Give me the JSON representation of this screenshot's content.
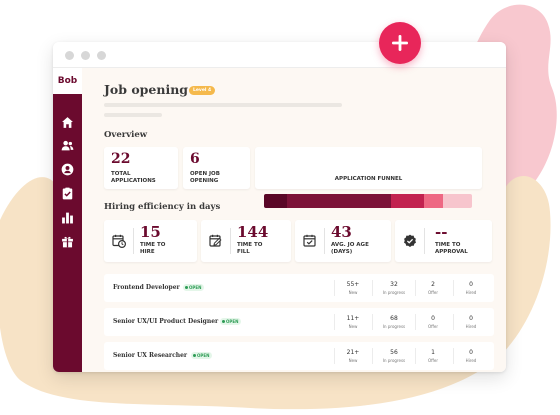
{
  "app": {
    "logo": "Bob"
  },
  "page": {
    "title": "Job opening",
    "badge": "Level 4"
  },
  "overview": {
    "heading": "Overview",
    "total_applications": {
      "value": "22",
      "label": "TOTAL APPLICATIONS"
    },
    "open_job_opening": {
      "value": "6",
      "label": "OPEN JOB OPENING"
    },
    "funnel": {
      "label": "APPLICATION FUNNEL",
      "segments": [
        {
          "fraction": 0.11,
          "color": "#5a0727"
        },
        {
          "fraction": 0.5,
          "color": "#7c1238"
        },
        {
          "fraction": 0.16,
          "color": "#c2224f"
        },
        {
          "fraction": 0.09,
          "color": "#ee6883"
        },
        {
          "fraction": 0.14,
          "color": "#f7c5cd"
        }
      ]
    }
  },
  "efficiency": {
    "heading": "Hiring efficiency in days",
    "time_to_hire": {
      "value": "15",
      "label": "TIME TO HIRE",
      "icon": "clock-calendar-icon"
    },
    "time_to_fill": {
      "value": "144",
      "label": "TIME TO FILL",
      "icon": "calendar-edit-icon"
    },
    "avg_job_age": {
      "value": "43",
      "label": "AVG. JO AGE (DAYS)",
      "icon": "calendar-check-icon"
    },
    "time_to_approval": {
      "value": "--",
      "label": "TIME TO APPROVAL",
      "icon": "check-circle-icon"
    }
  },
  "jobs": {
    "column_labels": {
      "new": "New",
      "in_progress": "In progress",
      "offer": "Offer",
      "hired": "Hired"
    },
    "status_label": "OPEN",
    "rows": [
      {
        "title": "Frontend Developer",
        "new": "55+",
        "in_progress": "32",
        "offer": "2",
        "hired": "0"
      },
      {
        "title": "Senior UX/UI Product Designer",
        "new": "11+",
        "in_progress": "68",
        "offer": "0",
        "hired": "0"
      },
      {
        "title": "Senior UX Researcher",
        "new": "21+",
        "in_progress": "56",
        "offer": "1",
        "hired": "0"
      }
    ]
  },
  "colors": {
    "brand": "#6b0a2e",
    "accent": "#e8265a",
    "badge": "#f5b94c",
    "open_status": "#2e9c55"
  },
  "icons": {
    "sidebar": [
      "home-icon",
      "people-icon",
      "profile-icon",
      "clipboard-check-icon",
      "bar-chart-icon",
      "gift-icon"
    ],
    "add_button": "plus-icon"
  }
}
